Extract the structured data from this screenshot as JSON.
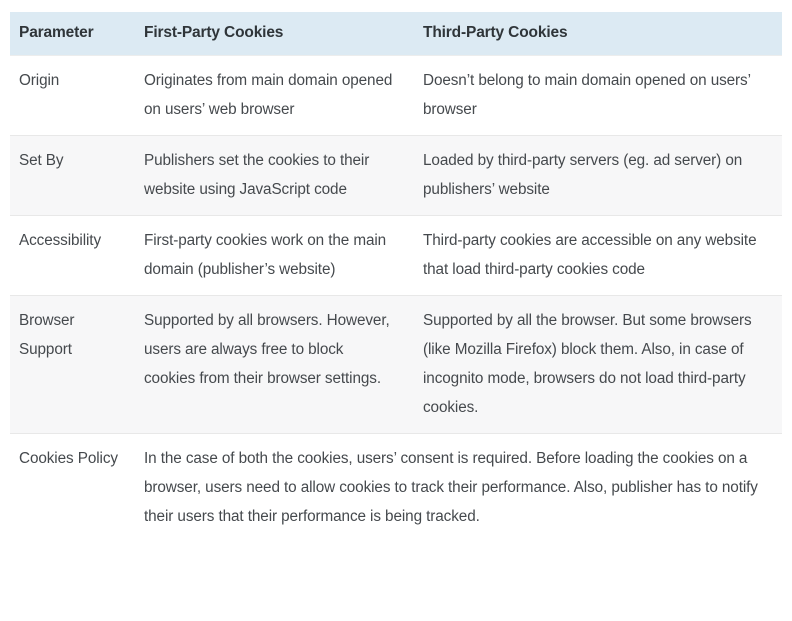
{
  "table": {
    "name": "first-party-vs-third-party-cookies-comparison",
    "header_background": "#dceaf3",
    "alt_row_background": "#f7f7f8",
    "columns": [
      {
        "key": "parameter",
        "label": "Parameter"
      },
      {
        "key": "first_party",
        "label": "First-Party Cookies"
      },
      {
        "key": "third_party",
        "label": "Third-Party Cookies"
      }
    ],
    "rows": [
      {
        "parameter": "Origin",
        "first_party": "Originates from main domain opened on users’ web browser",
        "third_party": "Doesn’t belong to main domain opened on users’ browser",
        "shaded": false,
        "spans_columns": false
      },
      {
        "parameter": "Set By",
        "first_party": "Publishers set the cookies to their website using JavaScript code",
        "third_party": "Loaded by third-party servers (eg. ad server) on publishers’ website",
        "shaded": true,
        "spans_columns": false
      },
      {
        "parameter": "Accessibility",
        "first_party": "First-party cookies work on the main domain (publisher’s website)",
        "third_party": "Third-party cookies are accessible on any website that load third-party cookies code",
        "shaded": false,
        "spans_columns": false
      },
      {
        "parameter": "Browser Support",
        "first_party": "Supported by all browsers. However, users are always free to block cookies from their browser settings.",
        "third_party": "Supported by all the browser. But some browsers (like Mozilla Firefox) block them. Also, in case of incognito mode, browsers do not load third-party cookies.",
        "shaded": true,
        "spans_columns": false
      },
      {
        "parameter": "Cookies Policy",
        "combined": "In the case of both the cookies, users’ consent is required. Before loading the cookies on a browser, users need to allow cookies to track their performance. Also, publisher has to notify their users that their performance is being tracked.",
        "shaded": false,
        "spans_columns": true
      }
    ]
  }
}
